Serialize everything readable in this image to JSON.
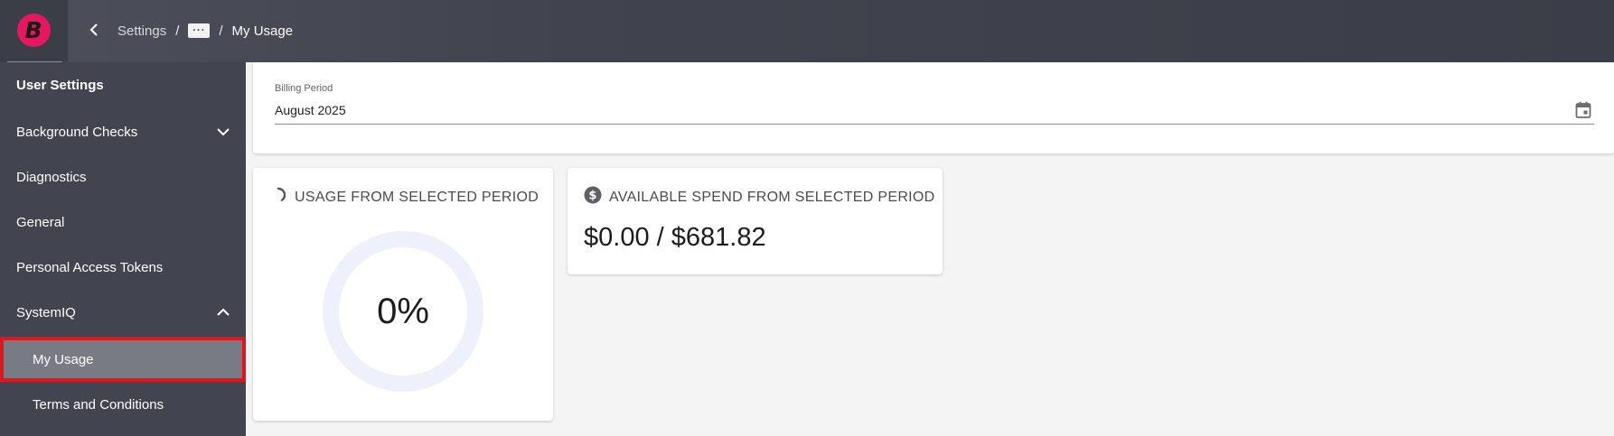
{
  "header": {
    "logo_letter": "B",
    "breadcrumb": {
      "settings": "Settings",
      "separator": "/",
      "more": "···",
      "current": "My Usage"
    }
  },
  "sidebar": {
    "title": "User Settings",
    "items": [
      {
        "label": "Background Checks",
        "expanded": false,
        "icon": "chevron-down-icon"
      },
      {
        "label": "Diagnostics"
      },
      {
        "label": "General"
      },
      {
        "label": "Personal Access Tokens"
      },
      {
        "label": "SystemIQ",
        "expanded": true,
        "icon": "chevron-up-icon"
      },
      {
        "label": "My Usage",
        "selected": true,
        "sub": true
      },
      {
        "label": "Terms and Conditions",
        "sub": true
      }
    ]
  },
  "billing": {
    "label": "Billing Period",
    "value": "August 2025",
    "icon": "calendar-icon"
  },
  "usage_card": {
    "title": "USAGE FROM SELECTED PERIOD",
    "icon": "spinner-icon",
    "percent_label": "0%",
    "percent": 0
  },
  "spend_card": {
    "title": "AVAILABLE SPEND FROM SELECTED PERIOD",
    "icon": "dollar-circle-icon",
    "value": "$0.00 / $681.82"
  },
  "colors": {
    "topbar": "#42444f",
    "sidebar": "#42444f",
    "selected_item": "#787b84",
    "highlight_border": "#e2151f",
    "brand": "#e5185f",
    "gauge_track": "#eef1fb"
  }
}
